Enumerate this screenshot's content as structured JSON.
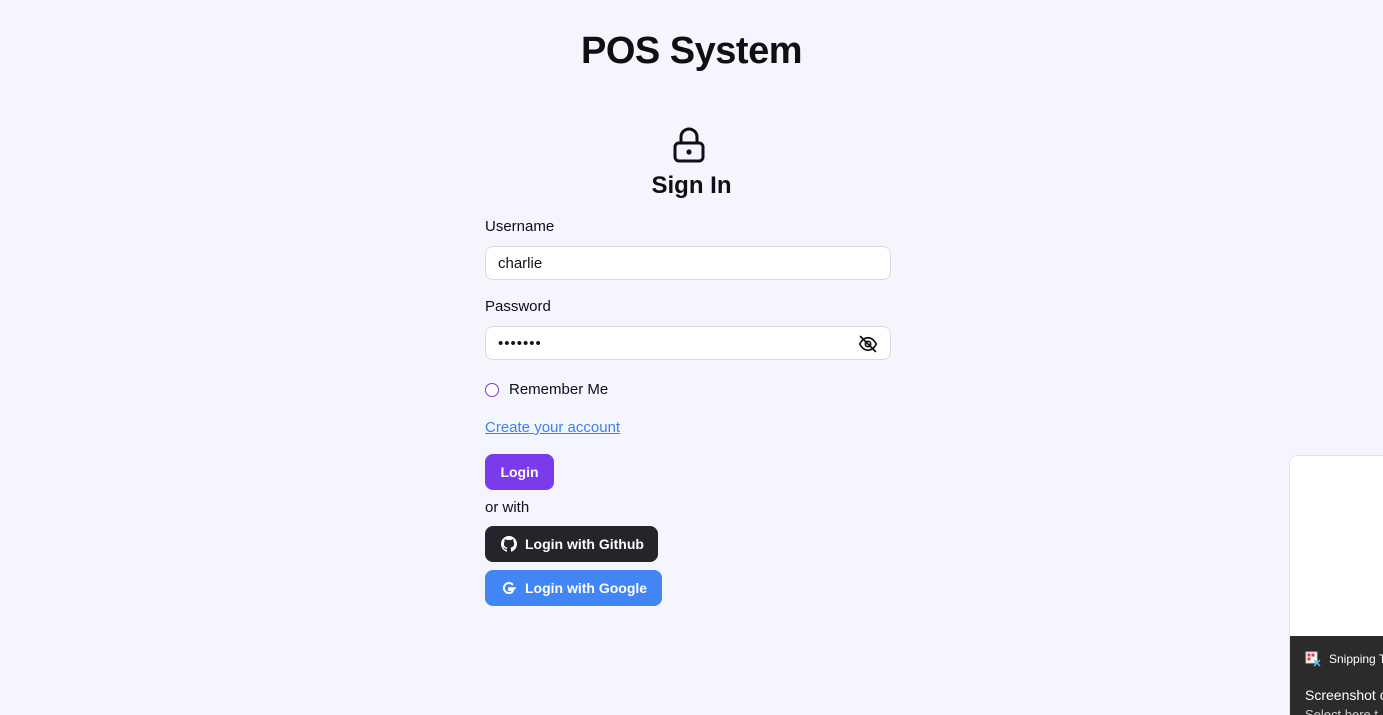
{
  "app": {
    "title": "POS System"
  },
  "form": {
    "heading": "Sign In",
    "username_label": "Username",
    "username_value": "charlie",
    "password_label": "Password",
    "password_value": "•••••••",
    "remember_label": "Remember Me",
    "create_account_link": "Create your account",
    "login_button": "Login",
    "or_with": "or with",
    "github_button": "Login with Github",
    "google_button": "Login with Google"
  },
  "toast": {
    "app_name": "Snipping T",
    "message": "Screenshot c",
    "sub": "Select here t"
  },
  "icons": {
    "lock": "lock-icon",
    "eye_off": "eye-off-icon",
    "github": "github-icon",
    "google": "google-icon",
    "snipping_tool": "snipping-tool-icon"
  },
  "colors": {
    "background": "#f4f5fd",
    "primary": "#7c3aed",
    "link": "#3b82f6",
    "github": "#24252b",
    "google": "#4285f4"
  }
}
